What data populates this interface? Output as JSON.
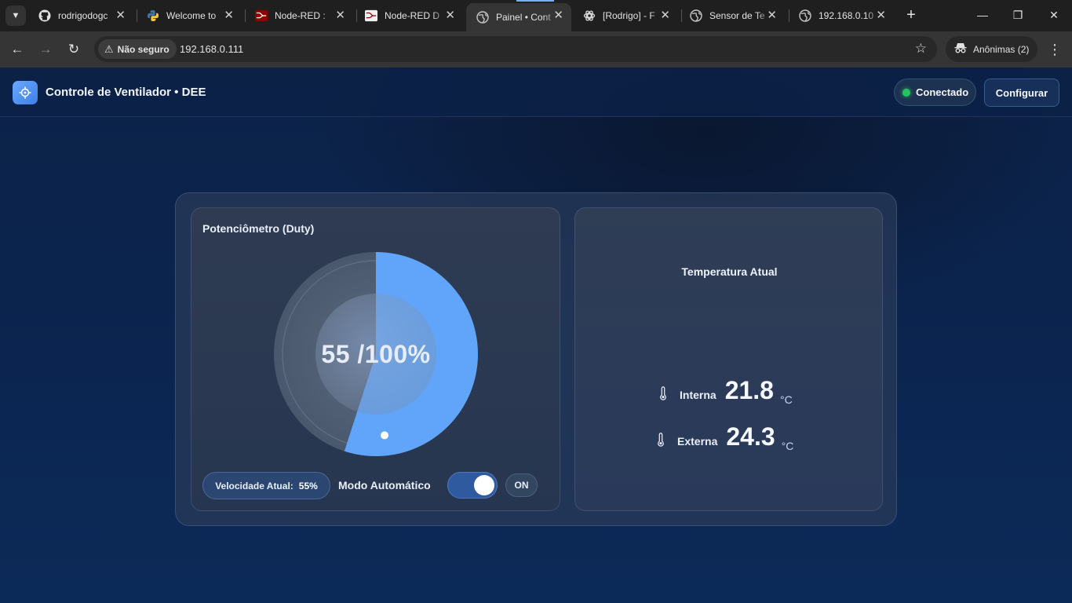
{
  "browser": {
    "tabs": [
      {
        "title": "rodrigodogc",
        "icon": "github-icon"
      },
      {
        "title": "Welcome to",
        "icon": "python-icon"
      },
      {
        "title": "Node-RED : ",
        "icon": "node-red-icon"
      },
      {
        "title": "Node-RED D",
        "icon": "node-red-icon"
      },
      {
        "title": "Painel • Cont",
        "icon": "globe-icon",
        "active": true
      },
      {
        "title": "[Rodrigo] - F",
        "icon": "openai-icon"
      },
      {
        "title": "Sensor de Te",
        "icon": "globe-icon"
      },
      {
        "title": "192.168.0.10",
        "icon": "globe-icon"
      }
    ],
    "security_label": "Não seguro",
    "url": "192.168.0.111",
    "profile_label": "Anônimas (2)"
  },
  "app": {
    "title": "Controle de Ventilador • DEE",
    "status": "Conectado",
    "status_color": "#22c55e",
    "config_label": "Configurar"
  },
  "pot_card": {
    "title": "Potenciômetro (Duty)",
    "gauge_text": "55 /100%",
    "duty_percent": 55,
    "accent_color": "#60a5fa",
    "speed_label": "Velocidade Atual:",
    "speed_value": "55%",
    "auto_label": "Modo Automático",
    "auto_on": true,
    "toggle_state": "ON"
  },
  "temp_card": {
    "title": "Temperatura Atual",
    "readings": [
      {
        "label": "Interna",
        "value": "21.8",
        "unit": "°C"
      },
      {
        "label": "Externa",
        "value": "24.3",
        "unit": "°C"
      }
    ]
  }
}
